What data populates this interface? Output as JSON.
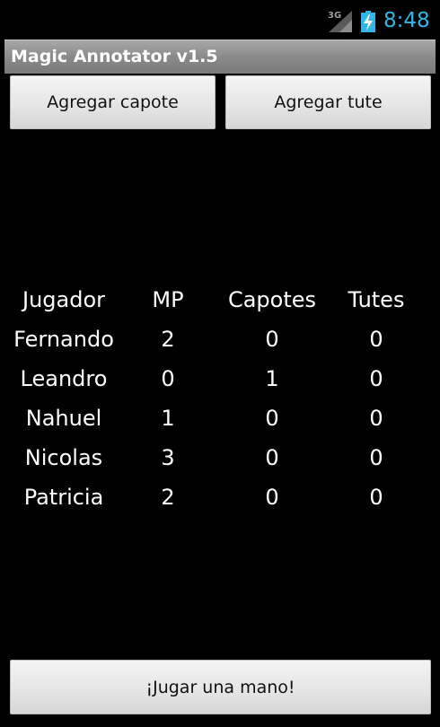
{
  "status_bar": {
    "network": "3G",
    "time": "8:48",
    "icons": [
      "signal-3g-icon",
      "battery-charging-icon"
    ],
    "clock_color": "#33b5e5"
  },
  "app": {
    "title": "Magic Annotator v1.5"
  },
  "buttons": {
    "add_capote": "Agregar capote",
    "add_tute": "Agregar tute",
    "play_hand": "¡Jugar una mano!"
  },
  "table": {
    "headers": [
      "Jugador",
      "MP",
      "Capotes",
      "Tutes"
    ],
    "rows": [
      {
        "player": "Fernando",
        "mp": "2",
        "capotes": "0",
        "tutes": "0"
      },
      {
        "player": "Leandro",
        "mp": "0",
        "capotes": "1",
        "tutes": "0"
      },
      {
        "player": "Nahuel",
        "mp": "1",
        "capotes": "0",
        "tutes": "0"
      },
      {
        "player": "Nicolas",
        "mp": "3",
        "capotes": "0",
        "tutes": "0"
      },
      {
        "player": "Patricia",
        "mp": "2",
        "capotes": "0",
        "tutes": "0"
      }
    ]
  }
}
